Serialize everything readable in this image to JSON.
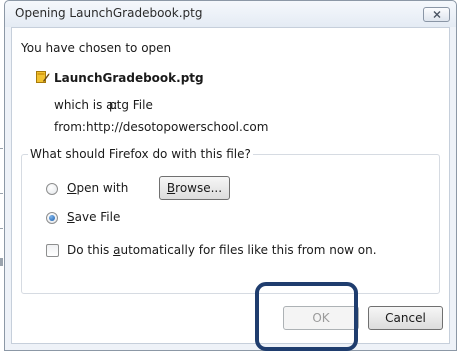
{
  "window": {
    "title": "Opening LaunchGradebook.ptg"
  },
  "download": {
    "intro": "You have chosen to open",
    "file_name": "LaunchGradebook.ptg",
    "which_is_label": "which is a:",
    "which_is_value": "ptg File",
    "from_label": "from:",
    "from_value": "http://desotopowerschool.com"
  },
  "options": {
    "question": "What should Firefox do with this file?",
    "open_with_first": "O",
    "open_with_rest": "pen with",
    "browse_first": "B",
    "browse_rest": "rowse...",
    "save_first": "S",
    "save_rest": "ave File",
    "selected": "save_file",
    "auto_pre": "Do this ",
    "auto_key": "a",
    "auto_post": "utomatically for files like this from now on.",
    "auto_checked": false
  },
  "buttons": {
    "ok": "OK",
    "cancel": "Cancel"
  },
  "icons": {
    "file": "ptg-file-icon",
    "close": "close-x-icon"
  },
  "colors": {
    "highlight": "#1f3d6e",
    "radio_selected": "#1b5fae"
  }
}
